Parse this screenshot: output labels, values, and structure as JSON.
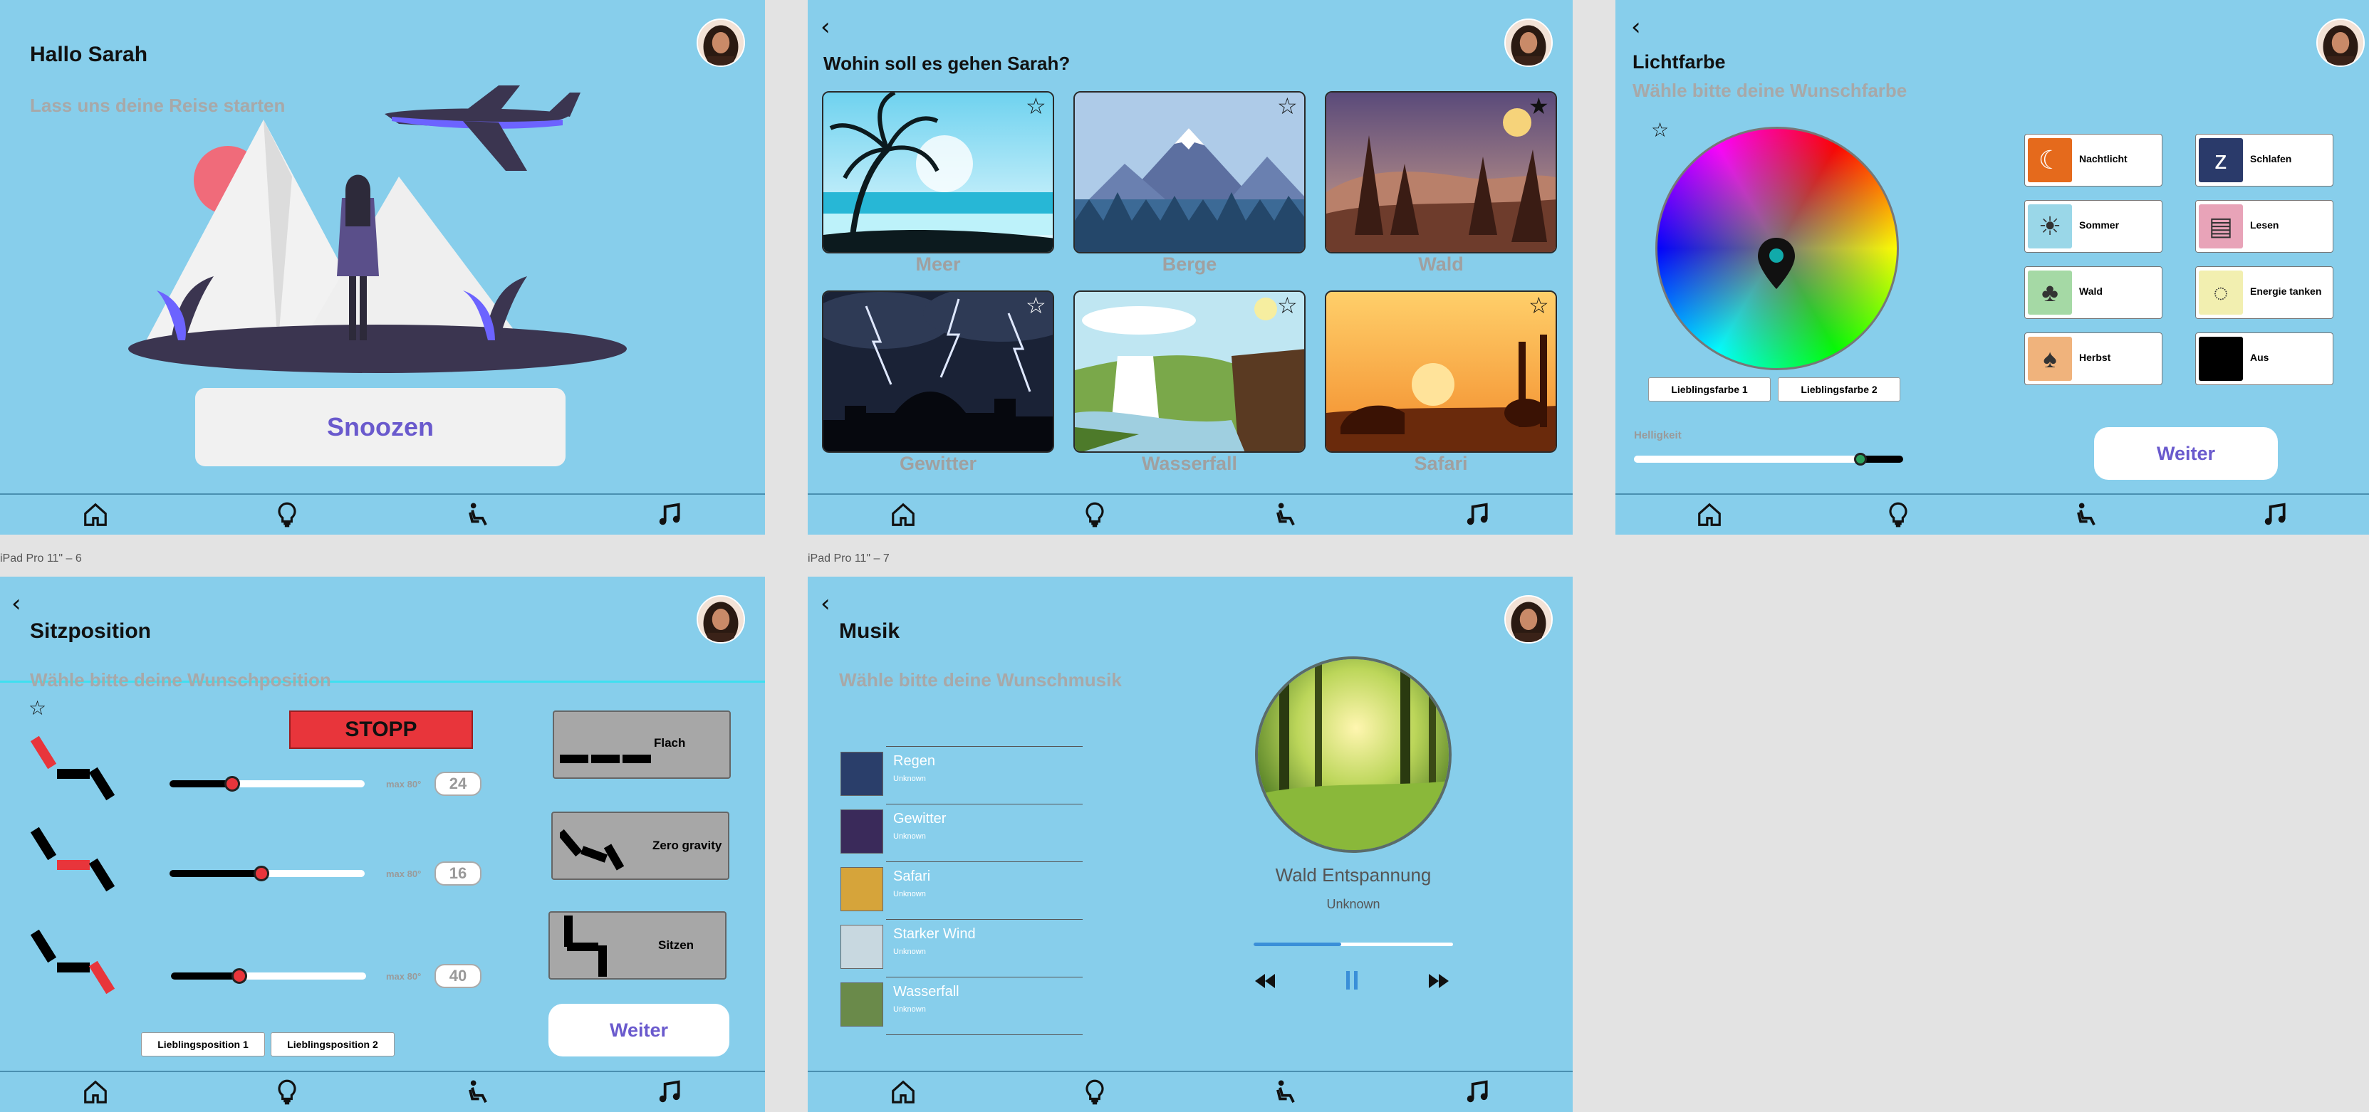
{
  "colors": {
    "screen_bg": "#87ceeb",
    "accent": "#6c63ff",
    "stop": "#e8353b",
    "label_gray": "#a0a0a0"
  },
  "nav": {
    "icons": [
      "home-icon",
      "lightbulb-icon",
      "seat-icon",
      "music-icon"
    ]
  },
  "frame_labels": {
    "frame6": "iPad Pro 11\" – 6",
    "frame7": "iPad Pro 11\" – 7"
  },
  "welcome": {
    "title": "Hallo Sarah",
    "subtitle": "Lass uns deine Reise starten",
    "snooze_label": "Snoozen"
  },
  "destinations": {
    "title": "Wohin soll es gehen Sarah?",
    "cards": [
      {
        "label": "Meer",
        "favorite": false
      },
      {
        "label": "Berge",
        "favorite": false
      },
      {
        "label": "Wald",
        "favorite": true
      },
      {
        "label": "Gewitter",
        "favorite": false
      },
      {
        "label": "Wasserfall",
        "favorite": false
      },
      {
        "label": "Safari",
        "favorite": false
      }
    ]
  },
  "light": {
    "title": "Lichtfarbe",
    "subtitle": "Wähle bitte deine Wunschfarbe",
    "fav1": "Lieblingsfarbe 1",
    "fav2": "Lieblingsfarbe 2",
    "brightness_label": "Helligkeit",
    "brightness_value": 0.84,
    "presets": [
      {
        "label": "Nachtlicht",
        "color": "#e56a1c",
        "icon": "moon-icon"
      },
      {
        "label": "Schlafen",
        "color": "#2a3a6a",
        "icon": "sleep-icon"
      },
      {
        "label": "Sommer",
        "color": "#9ad7e8",
        "icon": "sun-icon"
      },
      {
        "label": "Lesen",
        "color": "#e8a3b8",
        "icon": "book-icon"
      },
      {
        "label": "Wald",
        "color": "#a5d9a5",
        "icon": "tree-icon"
      },
      {
        "label": "Energie tanken",
        "color": "#f2efb0",
        "icon": "bulb-icon"
      },
      {
        "label": "Herbst",
        "color": "#f0b37c",
        "icon": "autumn-tree-icon"
      },
      {
        "label": "Aus",
        "color": "#000000",
        "icon": "off-icon"
      }
    ],
    "continue_label": "Weiter"
  },
  "seat": {
    "title": "Sitzposition",
    "subtitle": "Wähle bitte deine Wunschposition",
    "stop_label": "STOPP",
    "rows": [
      {
        "max_label": "max 80°",
        "value": "24",
        "level": 0.32
      },
      {
        "max_label": "max 80°",
        "value": "16",
        "level": 0.47
      },
      {
        "max_label": "max 80°",
        "value": "40",
        "level": 0.35
      }
    ],
    "presets": [
      {
        "label": "Flach"
      },
      {
        "label": "Zero gravity"
      },
      {
        "label": "Sitzen"
      }
    ],
    "fav1": "Lieblingsposition 1",
    "fav2": "Lieblingsposition 2",
    "continue_label": "Weiter"
  },
  "music": {
    "title": "Musik",
    "subtitle": "Wähle bitte deine Wunschmusik",
    "tracks": [
      {
        "name": "Regen",
        "artist": "Unknown",
        "thumb": "#2a3e6a"
      },
      {
        "name": "Gewitter",
        "artist": "Unknown",
        "thumb": "#3a2a5a"
      },
      {
        "name": "Safari",
        "artist": "Unknown",
        "thumb": "#d6a43a"
      },
      {
        "name": "Starker Wind",
        "artist": "Unknown",
        "thumb": "#c8d8e0"
      },
      {
        "name": "Wasserfall",
        "artist": "Unknown",
        "thumb": "#6a8a4a"
      }
    ],
    "now_playing": {
      "title": "Wald Entspannung",
      "artist": "Unknown",
      "progress": 0.44
    }
  }
}
